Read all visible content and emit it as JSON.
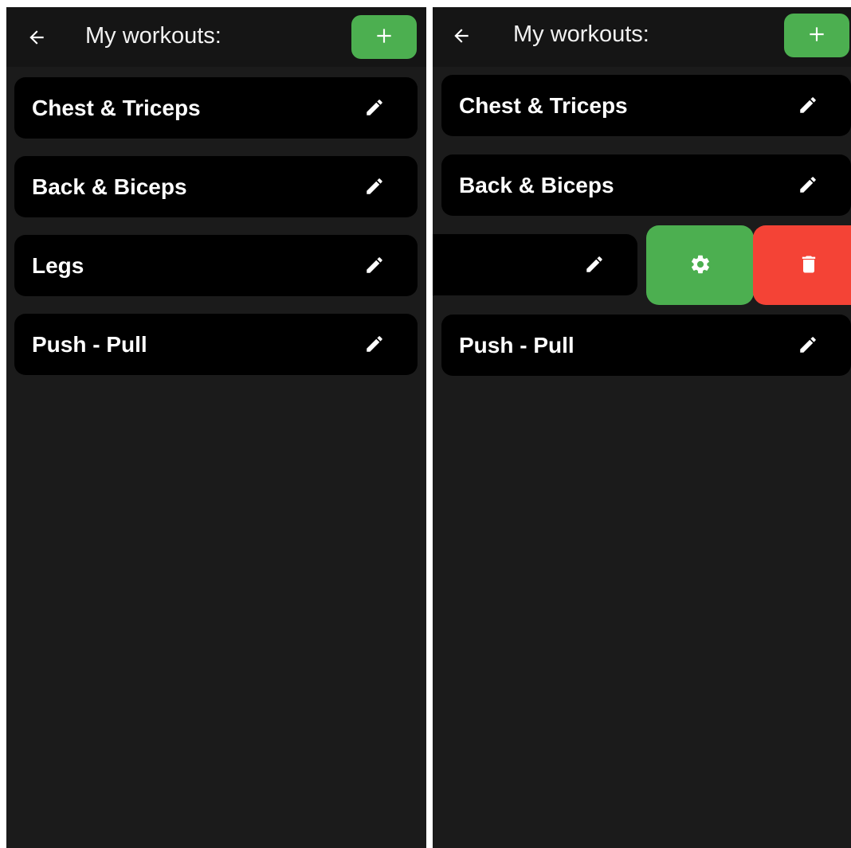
{
  "colors": {
    "screen_bg": "#1b1b1b",
    "appbar_bg": "#151515",
    "card_bg": "#000000",
    "accent_green": "#4caf50",
    "danger_red": "#f44336",
    "text": "#ffffff"
  },
  "screens": [
    {
      "header": {
        "back_icon": "arrow-left-icon",
        "title": "My workouts:",
        "add_icon": "plus-icon"
      },
      "workouts": [
        {
          "label": "Chest & Triceps",
          "icon": "pencil-icon"
        },
        {
          "label": "Back & Biceps",
          "icon": "pencil-icon"
        },
        {
          "label": "Legs",
          "icon": "pencil-icon"
        },
        {
          "label": "Push - Pull",
          "icon": "pencil-icon"
        }
      ]
    },
    {
      "header": {
        "back_icon": "arrow-left-icon",
        "title": "My workouts:",
        "add_icon": "plus-icon"
      },
      "workouts": [
        {
          "label": "Chest & Triceps",
          "icon": "pencil-icon"
        },
        {
          "label": "Back & Biceps",
          "icon": "pencil-icon"
        },
        {
          "label": "",
          "icon": "pencil-icon",
          "swiped": true
        },
        {
          "label": "Push - Pull",
          "icon": "pencil-icon"
        }
      ],
      "swipe_actions": [
        {
          "icon": "gear-icon",
          "color": "#4caf50"
        },
        {
          "icon": "trash-icon",
          "color": "#f44336"
        }
      ]
    }
  ]
}
